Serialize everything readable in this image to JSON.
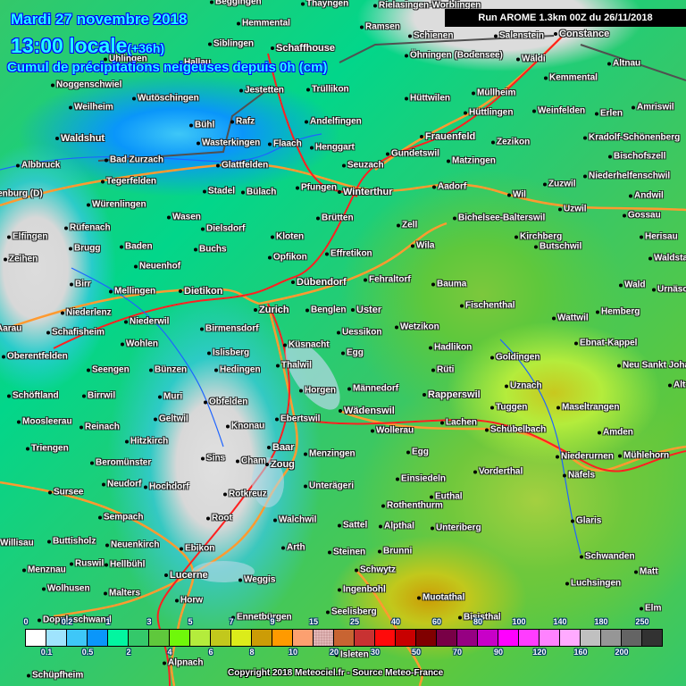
{
  "header": {
    "date": "Mardi 27 novembre 2018",
    "time": "13:00 locale",
    "lead": "(+36h)",
    "subtitle": "Cumul de précipitations neigeuses depuis 0h (cm)",
    "run": "Run AROME 1.3km 00Z du 26/11/2018"
  },
  "legend": {
    "colors": [
      "#ffffff",
      "#9fe3fd",
      "#3ec7f8",
      "#0a96fa",
      "#02f6a0",
      "#34c86a",
      "#5fc83c",
      "#6ff80a",
      "#b4ec3c",
      "#c2c81c",
      "#dcec1a",
      "#cc9c06",
      "#ff9a00",
      "#fca070",
      "#d0a0a0",
      "#c86432",
      "#c83232",
      "#ff0a0a",
      "#c80000",
      "#800000",
      "#780046",
      "#960082",
      "#c800c8",
      "#ff00ff",
      "#ff3cff",
      "#ff82ff",
      "#ffaaff",
      "#c0c0c0",
      "#969696",
      "#646464",
      "#323232"
    ],
    "top_labels": [
      "0",
      "0.2",
      "1",
      "3",
      "5",
      "7",
      "9",
      "15",
      "25",
      "40",
      "60",
      "80",
      "100",
      "140",
      "180",
      "250"
    ],
    "bottom_labels": [
      "0.1",
      "0.5",
      "2",
      "4",
      "6",
      "8",
      "10",
      "20",
      "30",
      "50",
      "70",
      "90",
      "120",
      "160",
      "200"
    ]
  },
  "map": {
    "cities": [
      "Beggingen",
      "Thayngen",
      "Rielasingen-Worblingen",
      "Hemmental",
      "Ramsen",
      "Schienen",
      "Salenstein",
      "Constance",
      "Siblingen",
      "Schaffhouse",
      "Öhningen (Bodensee)",
      "Wäldi",
      "Uhlingen",
      "Altnau",
      "Hallau",
      "Kemmental",
      "Noggenschwiel",
      "Wutöschingen",
      "Jestetten",
      "Trüllikon",
      "Hüttwilen",
      "Müllheim",
      "Weilheim",
      "Hüttlingen",
      "Weinfelden",
      "Erlen",
      "Amriswil",
      "Bühl",
      "Rafz",
      "Andelfingen",
      "Waldshut",
      "Wasterkingen",
      "Flaach",
      "Henggart",
      "Frauenfeld",
      "Zezikon",
      "Kradolf-Schönenberg",
      "Bad Zurzach",
      "Glattfelden",
      "Gundetswil",
      "Seuzach",
      "Matzingen",
      "Bischofszell",
      "Albbruck",
      "Tegerfelden",
      "Stadel",
      "Bülach",
      "Pfungen",
      "Winterthur",
      "Aadorf",
      "Wil",
      "Zuzwil",
      "Niederhelfenschwil",
      "Andwil",
      "Laufenburg (D)",
      "Würenlingen",
      "Wasen",
      "Brütten",
      "Bichelsee-Balterswil",
      "Uzwil",
      "Gossau",
      "Elfingen",
      "Rüfenach",
      "Dielsdorf",
      "Zell",
      "Kirchberg",
      "Herisau",
      "Zeihen",
      "Brugg",
      "Baden",
      "Buchs",
      "Kloten",
      "Wila",
      "Butschwil",
      "Waldstatt",
      "Effretikon",
      "Opfikon",
      "Neuenhof",
      "Fehraltorf",
      "Bauma",
      "Wald",
      "Urnäsch",
      "Birr",
      "Mellingen",
      "Dietikon",
      "Dübendorf",
      "Fischenthal",
      "Niederlenz",
      "Zurich",
      "Benglen",
      "Uster",
      "Wattwil",
      "Hemberg",
      "Niederwil",
      "Schafisheim",
      "Birmensdorf",
      "Uessikon",
      "Wetzikon",
      "Aarau",
      "Wohlen",
      "Küsnacht",
      "Hadlikon",
      "Ebnat-Kappel",
      "Islisberg",
      "Egg",
      "Oberentfelden",
      "Goldingen",
      "Seengen",
      "Bünzen",
      "Hedingen",
      "Thalwil",
      "Neu Sankt Johann",
      "Horgen",
      "Männedorf",
      "Rüti",
      "Uznach",
      "Schöftland",
      "Birrwil",
      "Muri",
      "Obfelden",
      "Rapperswil",
      "Tuggen",
      "Maseltrangen",
      "Alt St",
      "Moosleerau",
      "Reinach",
      "Geltwil",
      "Knonau",
      "Ebertswil",
      "Wädenswil",
      "Lachen",
      "Schübelbach",
      "Amden",
      "Triengen",
      "Hitzkirch",
      "Wollerau",
      "Baar",
      "Zoug",
      "Sins",
      "Cham",
      "Menzingen",
      "Egg",
      "Niederurnen",
      "Mühlehorn",
      "Beromünster",
      "Einsiedeln",
      "Vorderthal",
      "Näfels",
      "Neudorf",
      "Hochdorf",
      "Unterägeri",
      "Sursee",
      "Euthal",
      "Rotkreuz",
      "Rothenthurm",
      "Glaris",
      "Sempach",
      "Root",
      "Walchwil",
      "Sattel",
      "Alpthal",
      "Unteriberg",
      "Willisau",
      "Buttisholz",
      "Neuenkirch",
      "Ebikon",
      "Arth",
      "Steinen",
      "Brunni",
      "Schwanden",
      "Ruswil",
      "Hellbühl",
      "Lucerne",
      "Schwytz",
      "Matt",
      "Menznau",
      "Wolhusen",
      "Weggis",
      "Ingenbohl",
      "Luchsingen",
      "Malters",
      "Muotathal",
      "Horw",
      "Elm",
      "Seelisberg",
      "Ennetbürgen",
      "Bisisthal",
      "Doppleschwand",
      "Isleten",
      "Alpnach",
      "Schüpfheim"
    ]
  },
  "copyright": "Copyright 2018 Meteociel.fr - Source Meteo-France"
}
